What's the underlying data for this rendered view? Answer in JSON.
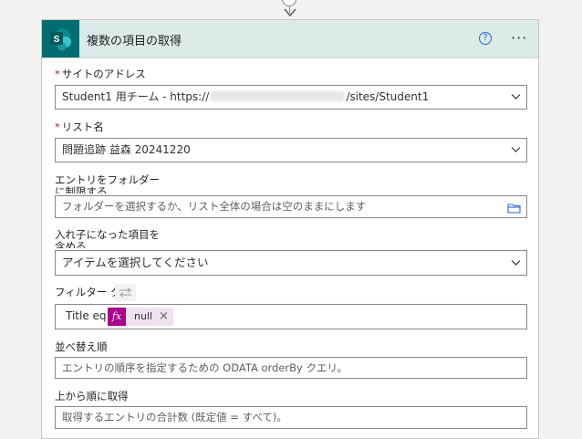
{
  "card": {
    "title": "複数の項目の取得",
    "help_glyph": "?",
    "more_glyph": "···",
    "accent_color": "#036c70"
  },
  "fields": {
    "site": {
      "required_mark": "*",
      "label": "サイトのアドレス",
      "value_prefix": "Student1 用チーム - https://",
      "value_suffix": "/sites/Student1"
    },
    "list": {
      "required_mark": "*",
      "label": "リスト名",
      "value": "問題追跡 益森 20241220"
    },
    "folder": {
      "label_line1": "エントリをフォルダー",
      "label_line2": "に制限する",
      "placeholder": "フォルダーを選択するか、リスト全体の場合は空のままにします"
    },
    "nested": {
      "label_line1": "入れ子になった項目を",
      "label_line2": "含める",
      "placeholder": "アイテムを選択してください"
    },
    "filter": {
      "label": "フィルター ク",
      "expression_text": "Title eq",
      "token_fx": "fx",
      "token_label": "null",
      "token_remove": "×"
    },
    "order": {
      "label": "並べ替え順",
      "placeholder": "エントリの順序を指定するための ODATA orderBy クエリ。"
    },
    "top": {
      "label": "上から順に取得",
      "placeholder": "取得するエントリの合計数 (既定値 = すべて)。"
    }
  }
}
